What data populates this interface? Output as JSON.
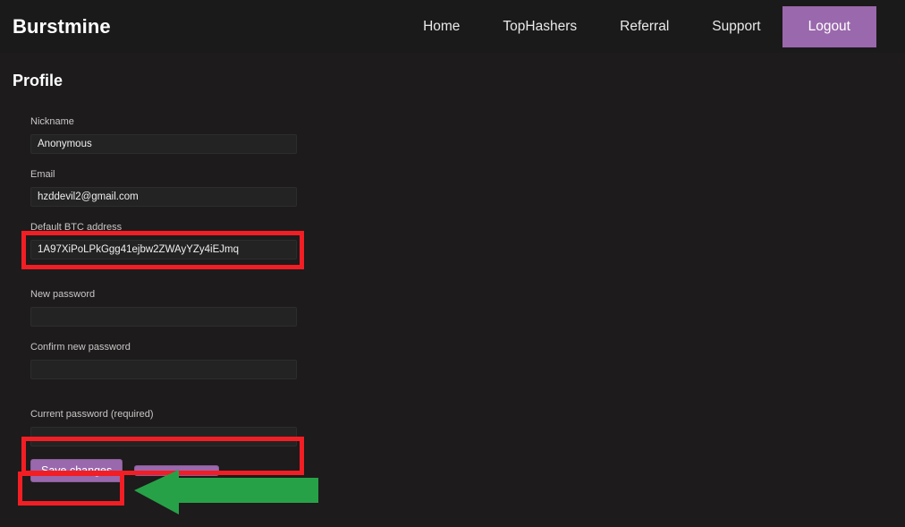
{
  "site": {
    "brand": "Burstmine",
    "background_color": "#1d1b1b",
    "accent_color": "#9a68ac",
    "annotation_color": "#f21e24",
    "arrow_color": "#27a148"
  },
  "navbar": {
    "brand": "Burstmine",
    "links": [
      {
        "label": "Home",
        "name": "nav-link-home"
      },
      {
        "label": "TopHashers",
        "name": "nav-link-tophashers"
      },
      {
        "label": "Referral",
        "name": "nav-link-referral"
      },
      {
        "label": "Support",
        "name": "nav-link-support"
      }
    ],
    "logout_label": "Logout"
  },
  "page": {
    "title": "Profile"
  },
  "form": {
    "nickname": {
      "label": "Nickname",
      "value": "Anonymous",
      "placeholder": ""
    },
    "email": {
      "label": "Email",
      "value": "hzddevil2@gmail.com",
      "placeholder": ""
    },
    "btc_address": {
      "label": "Default BTC address",
      "value": "1A97XiPoLPkGgg41ejbw2ZWAyYZy4iEJmq",
      "placeholder": ""
    },
    "new_password": {
      "label": "New password",
      "value": "",
      "placeholder": ""
    },
    "confirm_new_password": {
      "label": "Confirm new password",
      "value": "",
      "placeholder": ""
    },
    "current_password": {
      "label": "Current password (required)",
      "value": "",
      "placeholder": ""
    },
    "save_label": "Save changes",
    "secondary_label": ""
  },
  "annotations": {
    "btc_box": "highlight-btc-address",
    "current_password_box": "highlight-current-password",
    "save_box": "highlight-save-changes",
    "arrow": "green-arrow-pointing-left"
  }
}
